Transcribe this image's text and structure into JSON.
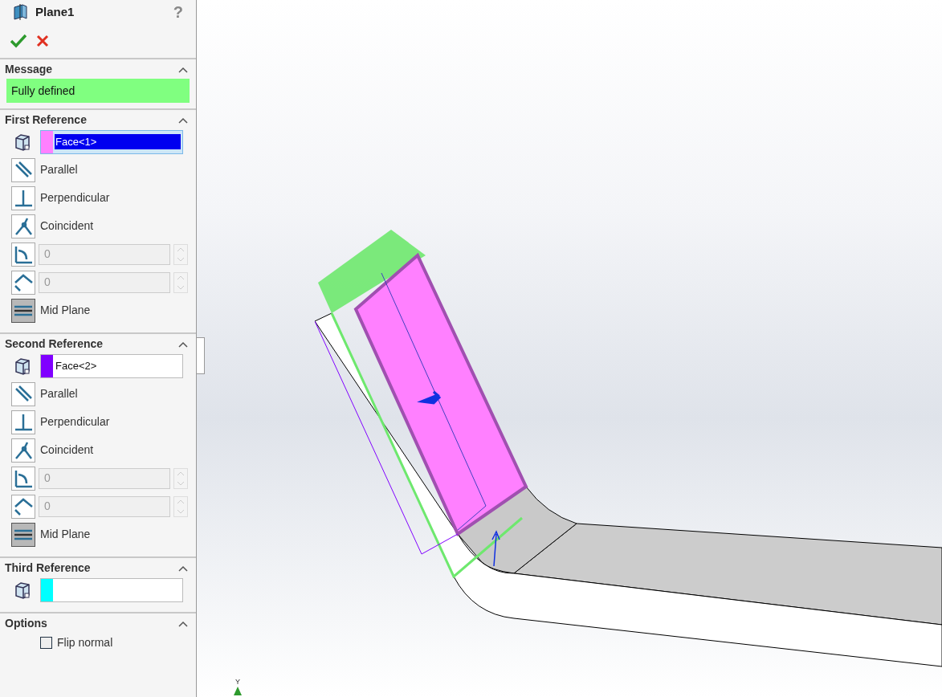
{
  "title": "Plane1",
  "help": "?",
  "sections": [
    {
      "kind": "message",
      "title": "Message",
      "expanded": true,
      "message": "Fully defined"
    },
    {
      "kind": "reference",
      "title": "First Reference",
      "expanded": true,
      "selection": {
        "value": "Face<1>",
        "color": "#ff80ff",
        "highlighted": true
      },
      "constraints": [
        {
          "kind": "parallel",
          "label": "Parallel",
          "selected": false
        },
        {
          "kind": "perpendicular",
          "label": "Perpendicular",
          "selected": false
        },
        {
          "kind": "coincident",
          "label": "Coincident",
          "selected": false
        },
        {
          "kind": "angle",
          "value": "0",
          "disabled": true
        },
        {
          "kind": "distance",
          "value": "0",
          "disabled": true
        },
        {
          "kind": "midplane",
          "label": "Mid Plane",
          "selected": true
        }
      ]
    },
    {
      "kind": "reference",
      "title": "Second Reference",
      "expanded": true,
      "selection": {
        "value": "Face<2>",
        "color": "#8000ff",
        "highlighted": false
      },
      "constraints": [
        {
          "kind": "parallel",
          "label": "Parallel",
          "selected": false
        },
        {
          "kind": "perpendicular",
          "label": "Perpendicular",
          "selected": false
        },
        {
          "kind": "coincident",
          "label": "Coincident",
          "selected": false
        },
        {
          "kind": "angle",
          "value": "0",
          "disabled": true
        },
        {
          "kind": "distance",
          "value": "0",
          "disabled": true
        },
        {
          "kind": "midplane",
          "label": "Mid Plane",
          "selected": true
        }
      ]
    },
    {
      "kind": "reference",
      "title": "Third Reference",
      "expanded": true,
      "selection": {
        "color": "#00ffff"
      }
    },
    {
      "kind": "options",
      "title": "Options",
      "expanded": true,
      "options": [
        {
          "label": "Flip normal",
          "checked": false
        }
      ]
    }
  ],
  "viewport": {
    "axis_label": "Y"
  }
}
